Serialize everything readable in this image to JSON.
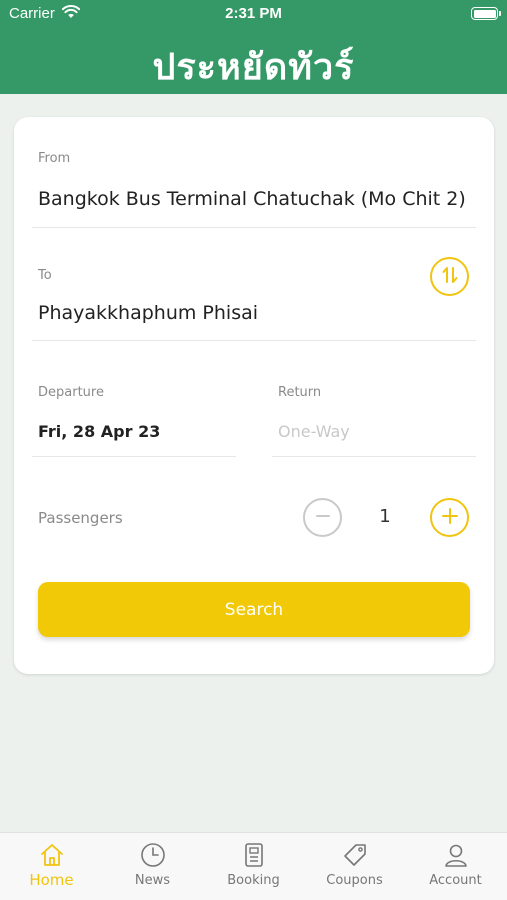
{
  "status_bar": {
    "carrier": "Carrier",
    "time": "2:31 PM"
  },
  "header": {
    "title": "ประหยัดทัวร์"
  },
  "form": {
    "from": {
      "label": "From",
      "value": "Bangkok Bus Terminal Chatuchak (Mo Chit 2)"
    },
    "to": {
      "label": "To",
      "value": "Phayakkhaphum Phisai"
    },
    "departure": {
      "label": "Departure",
      "value": "Fri, 28 Apr 23"
    },
    "return": {
      "label": "Return",
      "placeholder": "One-Way"
    },
    "passengers": {
      "label": "Passengers",
      "count": "1"
    },
    "search_label": "Search"
  },
  "tabbar": {
    "tabs": [
      {
        "label": "Home",
        "icon": "home-icon",
        "active": true
      },
      {
        "label": "News",
        "icon": "clock-icon",
        "active": false
      },
      {
        "label": "Booking",
        "icon": "document-icon",
        "active": false
      },
      {
        "label": "Coupons",
        "icon": "tag-icon",
        "active": false
      },
      {
        "label": "Account",
        "icon": "person-icon",
        "active": false
      }
    ]
  },
  "colors": {
    "brand_green": "#349966",
    "accent_yellow": "#f1c906",
    "background": "#ecf1ee"
  }
}
